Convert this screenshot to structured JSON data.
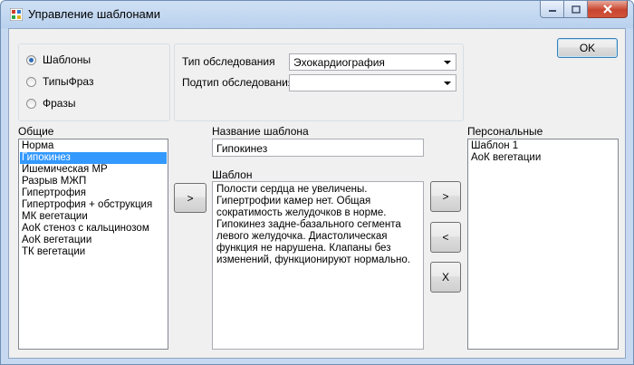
{
  "window": {
    "title": "Управление шаблонами"
  },
  "mode": {
    "options": [
      {
        "label": "Шаблоны",
        "checked": true
      },
      {
        "label": "ТипыФраз",
        "checked": false
      },
      {
        "label": "Фразы",
        "checked": false
      }
    ]
  },
  "exam": {
    "type_label": "Тип обследования",
    "type_value": "Эхокардиография",
    "subtype_label": "Подтип обследования",
    "subtype_value": ""
  },
  "common": {
    "label": "Общие",
    "items": [
      "Норма",
      "Гипокинез",
      "Ишемическая МР",
      "Разрыв МЖП",
      "Гипертрофия",
      "Гипертрофия + обструкция",
      "МК вегетации",
      "АоК стеноз с кальцинозом",
      "АоК вегетации",
      "ТК вегетации"
    ],
    "selected_index": 1
  },
  "template": {
    "name_label": "Название шаблона",
    "name_value": "Гипокинез",
    "text_label": "Шаблон",
    "text_value": "Полости сердца не увеличены. Гипертрофии камер нет. Общая сократимость желудочков в норме. Гипокинез задне-базального сегмента левого желудочка. Диастолическая функция не нарушена. Клапаны без изменений, функционируют нормально."
  },
  "personal": {
    "label": "Персональные",
    "items": [
      "Шаблон 1",
      "АоК вегетации"
    ]
  },
  "buttons": {
    "copy_to_template": ">",
    "move_right": ">",
    "move_left": "<",
    "delete": "X",
    "ok": "OK"
  }
}
